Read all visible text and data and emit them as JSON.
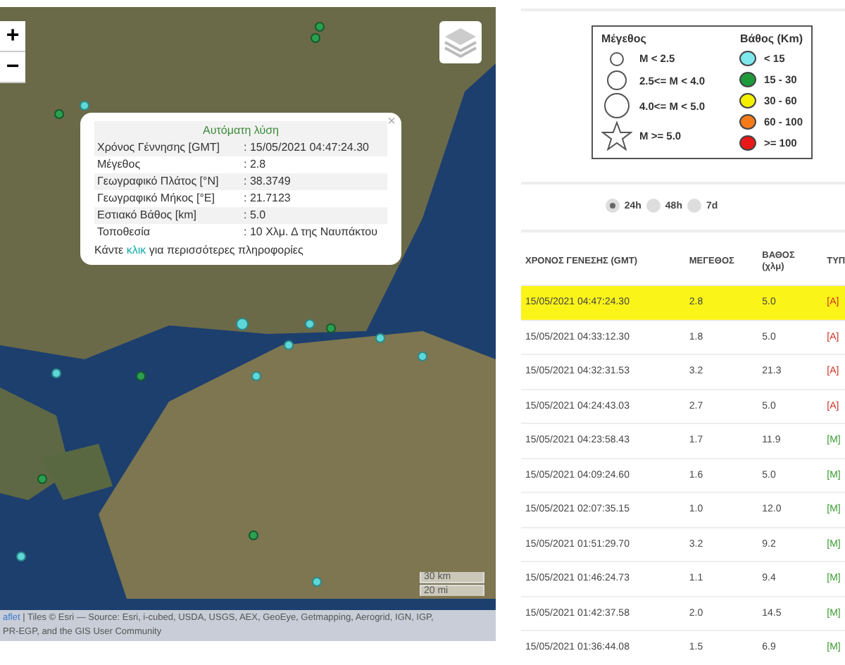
{
  "map": {
    "zoom_in": "+",
    "zoom_out": "−",
    "scale": [
      "30 km",
      "20 mi"
    ],
    "attribution": {
      "link": "aflet",
      "line1": "| Tiles © Esri — Source: Esri, i-cubed, USDA, USGS, AEX, GeoEye, Getmapping, Aerogrid, IGN, IGP,",
      "line2": "PR-EGP, and the GIS User Community"
    },
    "popup": {
      "close": "×",
      "title": "Αυτόματη λύση",
      "rows": [
        {
          "label": "Χρόνος Γέννησης [GMT]",
          "value": ": 15/05/2021 04:47:24.30"
        },
        {
          "label": "Μέγεθος",
          "value": ": 2.8"
        },
        {
          "label": "Γεωγραφικό Πλάτος [°N]",
          "value": ": 38.3749"
        },
        {
          "label": "Γεωγραφικό Μήκος [°E]",
          "value": ": 21.7123"
        },
        {
          "label": "Εστιακό Βάθος [km]",
          "value": ": 5.0"
        },
        {
          "label": "Τοποθεσία",
          "value": ": 10 Χλμ. Δ της Ναυπάκτου"
        }
      ],
      "footer": {
        "before": "Κάντε",
        "link": "κλικ",
        "after": "για περισσότερες πληροφορίες"
      }
    }
  },
  "legend": {
    "magnitude_title": "Μέγεθος",
    "depth_title": "Βάθος (Km)",
    "magnitudes": [
      {
        "kind": "circle-small",
        "label": "M < 2.5"
      },
      {
        "kind": "circle-medium",
        "label": "2.5<= M < 4.0"
      },
      {
        "kind": "circle-large",
        "label": "4.0<= M < 5.0"
      },
      {
        "kind": "star",
        "label": "M >= 5.0"
      }
    ],
    "depths": [
      {
        "color": "#7fe8ec",
        "label": "< 15"
      },
      {
        "color": "#1e9a3a",
        "label": "15 - 30"
      },
      {
        "color": "#f4f000",
        "label": "30 - 60"
      },
      {
        "color": "#f47a1a",
        "label": "60 - 100"
      },
      {
        "color": "#e81818",
        "label": ">= 100"
      }
    ]
  },
  "periods": [
    {
      "label": "24h",
      "selected": true
    },
    {
      "label": "48h",
      "selected": false
    },
    {
      "label": "7d",
      "selected": false
    }
  ],
  "table": {
    "columns": [
      "ΧΡΟΝΟΣ ΓΕΝΕΣΗΣ (GMT)",
      "ΜΕΓΕΘΟΣ",
      "ΒΑΘΟΣ (χλμ)",
      "ΤΥΠ"
    ],
    "rows": [
      {
        "time": "15/05/2021 04:47:24.30",
        "magnitude": "2.8",
        "depth": "5.0",
        "type": "[A]",
        "color": "#d03020",
        "selected": true
      },
      {
        "time": "15/05/2021 04:33:12.30",
        "magnitude": "1.8",
        "depth": "5.0",
        "type": "[A]",
        "color": "#d03020",
        "selected": false
      },
      {
        "time": "15/05/2021 04:32:31.53",
        "magnitude": "3.2",
        "depth": "21.3",
        "type": "[A]",
        "color": "#d03020",
        "selected": false
      },
      {
        "time": "15/05/2021 04:24:43.03",
        "magnitude": "2.7",
        "depth": "5.0",
        "type": "[A]",
        "color": "#d03020",
        "selected": false
      },
      {
        "time": "15/05/2021 04:23:58.43",
        "magnitude": "1.7",
        "depth": "11.9",
        "type": "[M]",
        "color": "#3a9a30",
        "selected": false
      },
      {
        "time": "15/05/2021 04:09:24.60",
        "magnitude": "1.6",
        "depth": "5.0",
        "type": "[M]",
        "color": "#3a9a30",
        "selected": false
      },
      {
        "time": "15/05/2021 02:07:35.15",
        "magnitude": "1.0",
        "depth": "12.0",
        "type": "[M]",
        "color": "#3a9a30",
        "selected": false
      },
      {
        "time": "15/05/2021 01:51:29.70",
        "magnitude": "3.2",
        "depth": "9.2",
        "type": "[M]",
        "color": "#3a9a30",
        "selected": false
      },
      {
        "time": "15/05/2021 01:46:24.73",
        "magnitude": "1.1",
        "depth": "9.4",
        "type": "[M]",
        "color": "#3a9a30",
        "selected": false
      },
      {
        "time": "15/05/2021 01:42:37.58",
        "magnitude": "2.0",
        "depth": "14.5",
        "type": "[M]",
        "color": "#3a9a30",
        "selected": false
      },
      {
        "time": "15/05/2021 01:36:44.08",
        "magnitude": "1.5",
        "depth": "6.9",
        "type": "[M]",
        "color": "#3a9a30",
        "selected": false
      }
    ]
  }
}
